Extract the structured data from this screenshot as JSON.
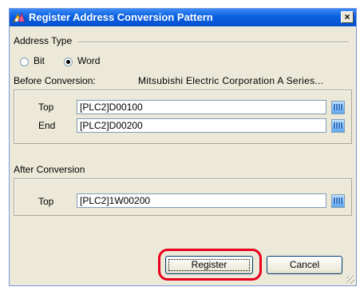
{
  "window": {
    "title": "Register Address Conversion Pattern",
    "close_label": "×"
  },
  "address_type": {
    "label": "Address Type",
    "options": [
      {
        "label": "Bit",
        "selected": false
      },
      {
        "label": "Word",
        "selected": true
      }
    ]
  },
  "before": {
    "label": "Before Conversion:",
    "device": "Mitsubishi Electric Corporation A Series...",
    "top_label": "Top",
    "top_value": "[PLC2]D00100",
    "end_label": "End",
    "end_value": "[PLC2]D00200"
  },
  "after": {
    "label": "After Conversion",
    "top_label": "Top",
    "top_value": "[PLC2]1W00200"
  },
  "buttons": {
    "register": "Register",
    "cancel": "Cancel"
  },
  "colors": {
    "title_bar": "#0a5fde",
    "dialog_bg": "#ece9d8",
    "highlight": "#e8001c"
  }
}
